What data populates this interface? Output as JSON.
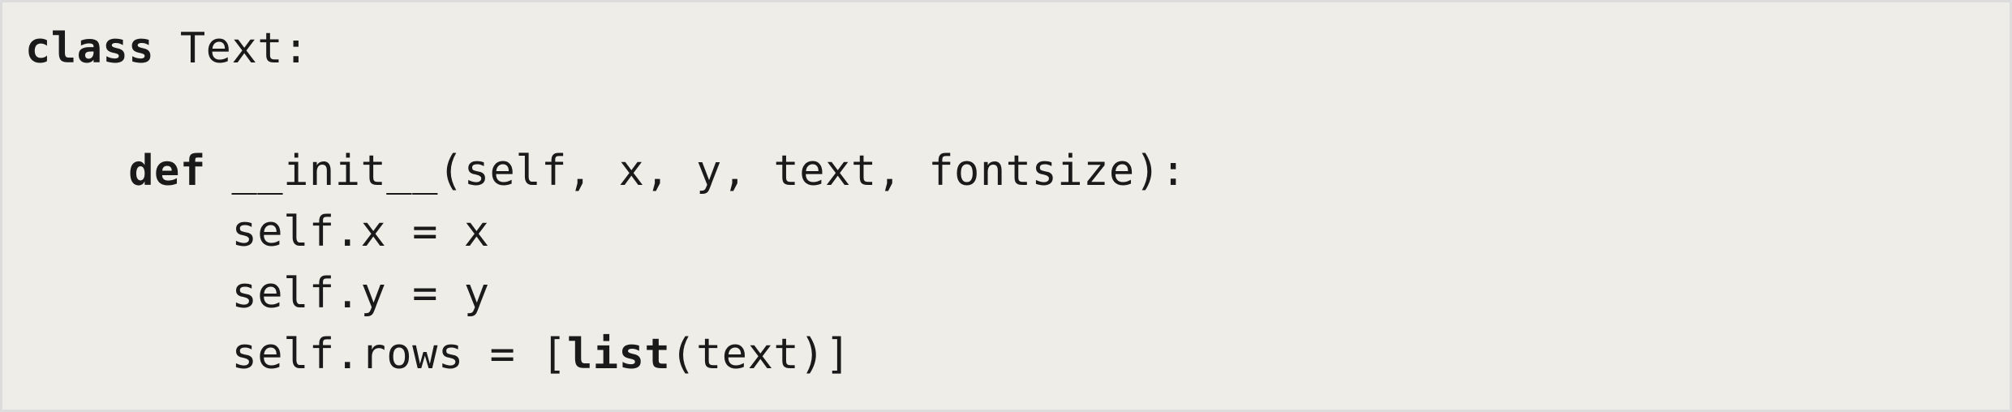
{
  "code": {
    "lines": [
      {
        "segments": [
          {
            "text": "class",
            "bold": true
          },
          {
            "text": " Text:",
            "bold": false
          }
        ]
      },
      {
        "segments": [
          {
            "text": "",
            "bold": false
          }
        ]
      },
      {
        "segments": [
          {
            "text": "    ",
            "bold": false
          },
          {
            "text": "def",
            "bold": true
          },
          {
            "text": " __init__(self, x, y, text, fontsize):",
            "bold": false
          }
        ]
      },
      {
        "segments": [
          {
            "text": "        self.x = x",
            "bold": false
          }
        ]
      },
      {
        "segments": [
          {
            "text": "        self.y = y",
            "bold": false
          }
        ]
      },
      {
        "segments": [
          {
            "text": "        self.rows = [",
            "bold": false
          },
          {
            "text": "list",
            "bold": true
          },
          {
            "text": "(text)]",
            "bold": false
          }
        ]
      }
    ]
  }
}
